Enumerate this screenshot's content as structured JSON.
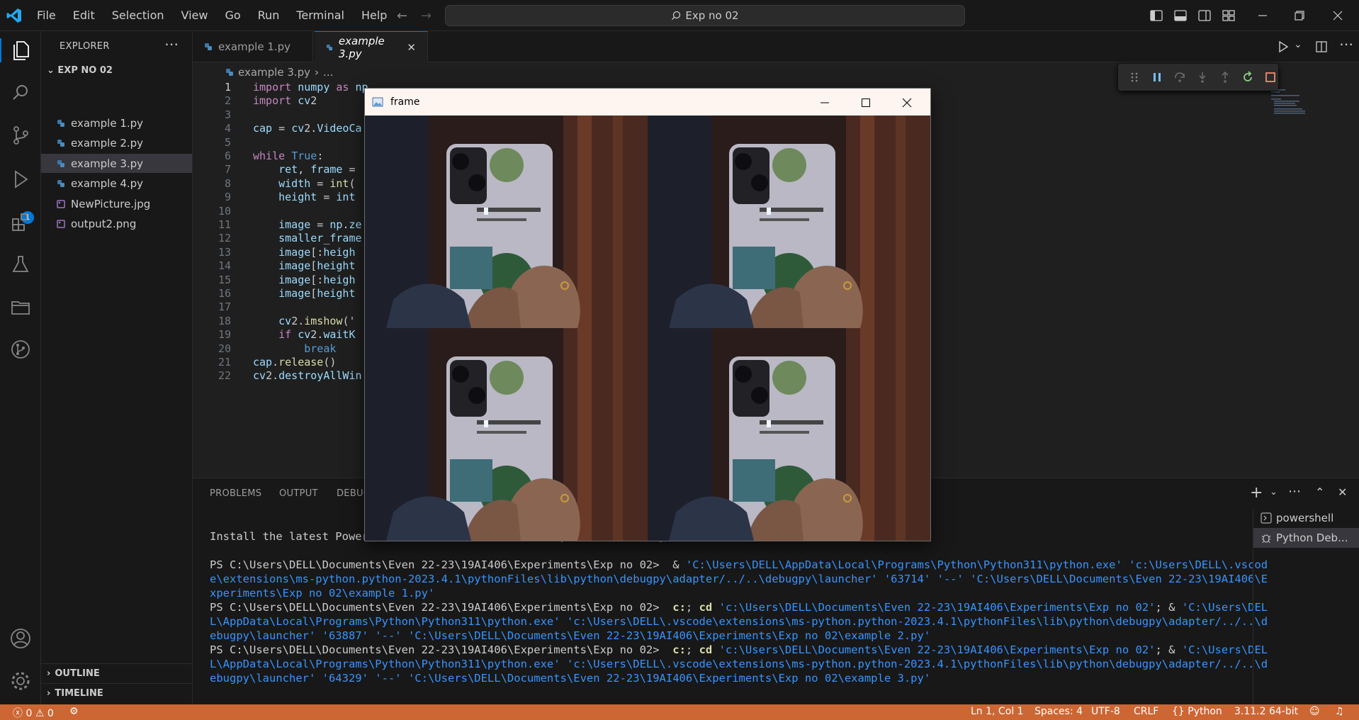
{
  "menu": [
    "File",
    "Edit",
    "Selection",
    "View",
    "Go",
    "Run",
    "Terminal",
    "Help"
  ],
  "search": {
    "text": "Exp no 02"
  },
  "explorer": {
    "title": "EXPLORER",
    "folder": "EXP NO 02",
    "files": [
      "example 1.py",
      "example 2.py",
      "example 3.py",
      "example 4.py",
      "NewPicture.jpg",
      "output2.png"
    ],
    "selected": "example 3.py",
    "outline": "OUTLINE",
    "timeline": "TIMELINE"
  },
  "activity": {
    "debug_badge": "1"
  },
  "tabs": [
    {
      "label": "example 1.py",
      "active": false
    },
    {
      "label": "example 3.py",
      "active": true
    }
  ],
  "breadcrumb": {
    "file": "example 3.py",
    "rest": "..."
  },
  "code": [
    {
      "n": "1",
      "t": "import numpy as np"
    },
    {
      "n": "2",
      "t": "import cv2"
    },
    {
      "n": "3",
      "t": ""
    },
    {
      "n": "4",
      "t": "cap = cv2.VideoCa"
    },
    {
      "n": "5",
      "t": ""
    },
    {
      "n": "6",
      "t": "while True:"
    },
    {
      "n": "7",
      "t": "    ret, frame = "
    },
    {
      "n": "8",
      "t": "    width = int("
    },
    {
      "n": "9",
      "t": "    height = int"
    },
    {
      "n": "10",
      "t": ""
    },
    {
      "n": "11",
      "t": "    image = np.ze"
    },
    {
      "n": "12",
      "t": "    smaller_frame"
    },
    {
      "n": "13",
      "t": "    image[:heigh"
    },
    {
      "n": "14",
      "t": "    image[height"
    },
    {
      "n": "15",
      "t": "    image[:heigh"
    },
    {
      "n": "16",
      "t": "    image[height"
    },
    {
      "n": "17",
      "t": ""
    },
    {
      "n": "18",
      "t": "    cv2.imshow('"
    },
    {
      "n": "19",
      "t": "    if cv2.waitK"
    },
    {
      "n": "20",
      "t": "        break"
    },
    {
      "n": "21",
      "t": "cap.release()"
    },
    {
      "n": "22",
      "t": "cv2.destroyAllWin"
    }
  ],
  "panel": {
    "tabs": [
      "PROBLEMS",
      "OUTPUT",
      "DEBUG"
    ],
    "terminal": [
      {
        "parts": [
          {
            "c": "",
            "t": "Install the latest PowerShell for new features and improvements! https://aka.ms/PSWindows"
          }
        ]
      },
      {
        "parts": [
          {
            "c": "",
            "t": ""
          }
        ]
      },
      {
        "parts": [
          {
            "c": "",
            "t": "PS C:\\Users\\DELL\\Documents\\Even 22-23\\19AI406\\Experiments\\Exp no 02>  & "
          },
          {
            "c": "tblue",
            "t": "'C:\\Users\\DELL\\AppData\\Local\\Programs\\Python\\Python311\\python.exe' 'c:\\Users\\DELL\\.vscod"
          }
        ]
      },
      {
        "parts": [
          {
            "c": "tblue",
            "t": "e\\extensions\\ms-python.python-2023.4.1\\pythonFiles\\lib\\python\\debugpy\\adapter/../..\\debugpy\\launcher' '63714' '--' 'C:\\Users\\DELL\\Documents\\Even 22-23\\19AI406\\E"
          }
        ]
      },
      {
        "parts": [
          {
            "c": "tblue",
            "t": "xperiments\\Exp no 02\\example 1.py'"
          }
        ]
      },
      {
        "parts": [
          {
            "c": "",
            "t": "PS C:\\Users\\DELL\\Documents\\Even 22-23\\19AI406\\Experiments\\Exp no 02>  "
          },
          {
            "c": "tyel",
            "t": "c:"
          },
          {
            "c": "",
            "t": "; "
          },
          {
            "c": "tyel",
            "t": "cd"
          },
          {
            "c": "",
            "t": " "
          },
          {
            "c": "tblue",
            "t": "'c:\\Users\\DELL\\Documents\\Even 22-23\\19AI406\\Experiments\\Exp no 02'"
          },
          {
            "c": "",
            "t": "; & "
          },
          {
            "c": "tblue",
            "t": "'C:\\Users\\DEL"
          }
        ]
      },
      {
        "parts": [
          {
            "c": "tblue",
            "t": "L\\AppData\\Local\\Programs\\Python\\Python311\\python.exe' 'c:\\Users\\DELL\\.vscode\\extensions\\ms-python.python-2023.4.1\\pythonFiles\\lib\\python\\debugpy\\adapter/../..\\d"
          }
        ]
      },
      {
        "parts": [
          {
            "c": "tblue",
            "t": "ebugpy\\launcher' '63887' '--' 'C:\\Users\\DELL\\Documents\\Even 22-23\\19AI406\\Experiments\\Exp no 02\\example 2.py'"
          }
        ]
      },
      {
        "parts": [
          {
            "c": "",
            "t": "PS C:\\Users\\DELL\\Documents\\Even 22-23\\19AI406\\Experiments\\Exp no 02>  "
          },
          {
            "c": "tyel",
            "t": "c:"
          },
          {
            "c": "",
            "t": "; "
          },
          {
            "c": "tyel",
            "t": "cd"
          },
          {
            "c": "",
            "t": " "
          },
          {
            "c": "tblue",
            "t": "'c:\\Users\\DELL\\Documents\\Even 22-23\\19AI406\\Experiments\\Exp no 02'"
          },
          {
            "c": "",
            "t": "; & "
          },
          {
            "c": "tblue",
            "t": "'C:\\Users\\DEL"
          }
        ]
      },
      {
        "parts": [
          {
            "c": "tblue",
            "t": "L\\AppData\\Local\\Programs\\Python\\Python311\\python.exe' 'c:\\Users\\DELL\\.vscode\\extensions\\ms-python.python-2023.4.1\\pythonFiles\\lib\\python\\debugpy\\adapter/../..\\d"
          }
        ]
      },
      {
        "parts": [
          {
            "c": "tblue",
            "t": "ebugpy\\launcher' '64329' '--' 'C:\\Users\\DELL\\Documents\\Even 22-23\\19AI406\\Experiments\\Exp no 02\\example 3.py'"
          }
        ]
      }
    ],
    "terminals": [
      "powershell",
      "Python Deb..."
    ]
  },
  "frame_window": {
    "title": "frame"
  },
  "status": {
    "errors": "0",
    "warnings": "0",
    "position": "Ln 1, Col 1",
    "spaces": "Spaces: 4",
    "encoding": "UTF-8",
    "eol": "CRLF",
    "language": "Python",
    "interpreter": "3.11.2 64-bit"
  },
  "colors": {
    "accent": "#0078d4",
    "status_debug": "#cc6633"
  }
}
